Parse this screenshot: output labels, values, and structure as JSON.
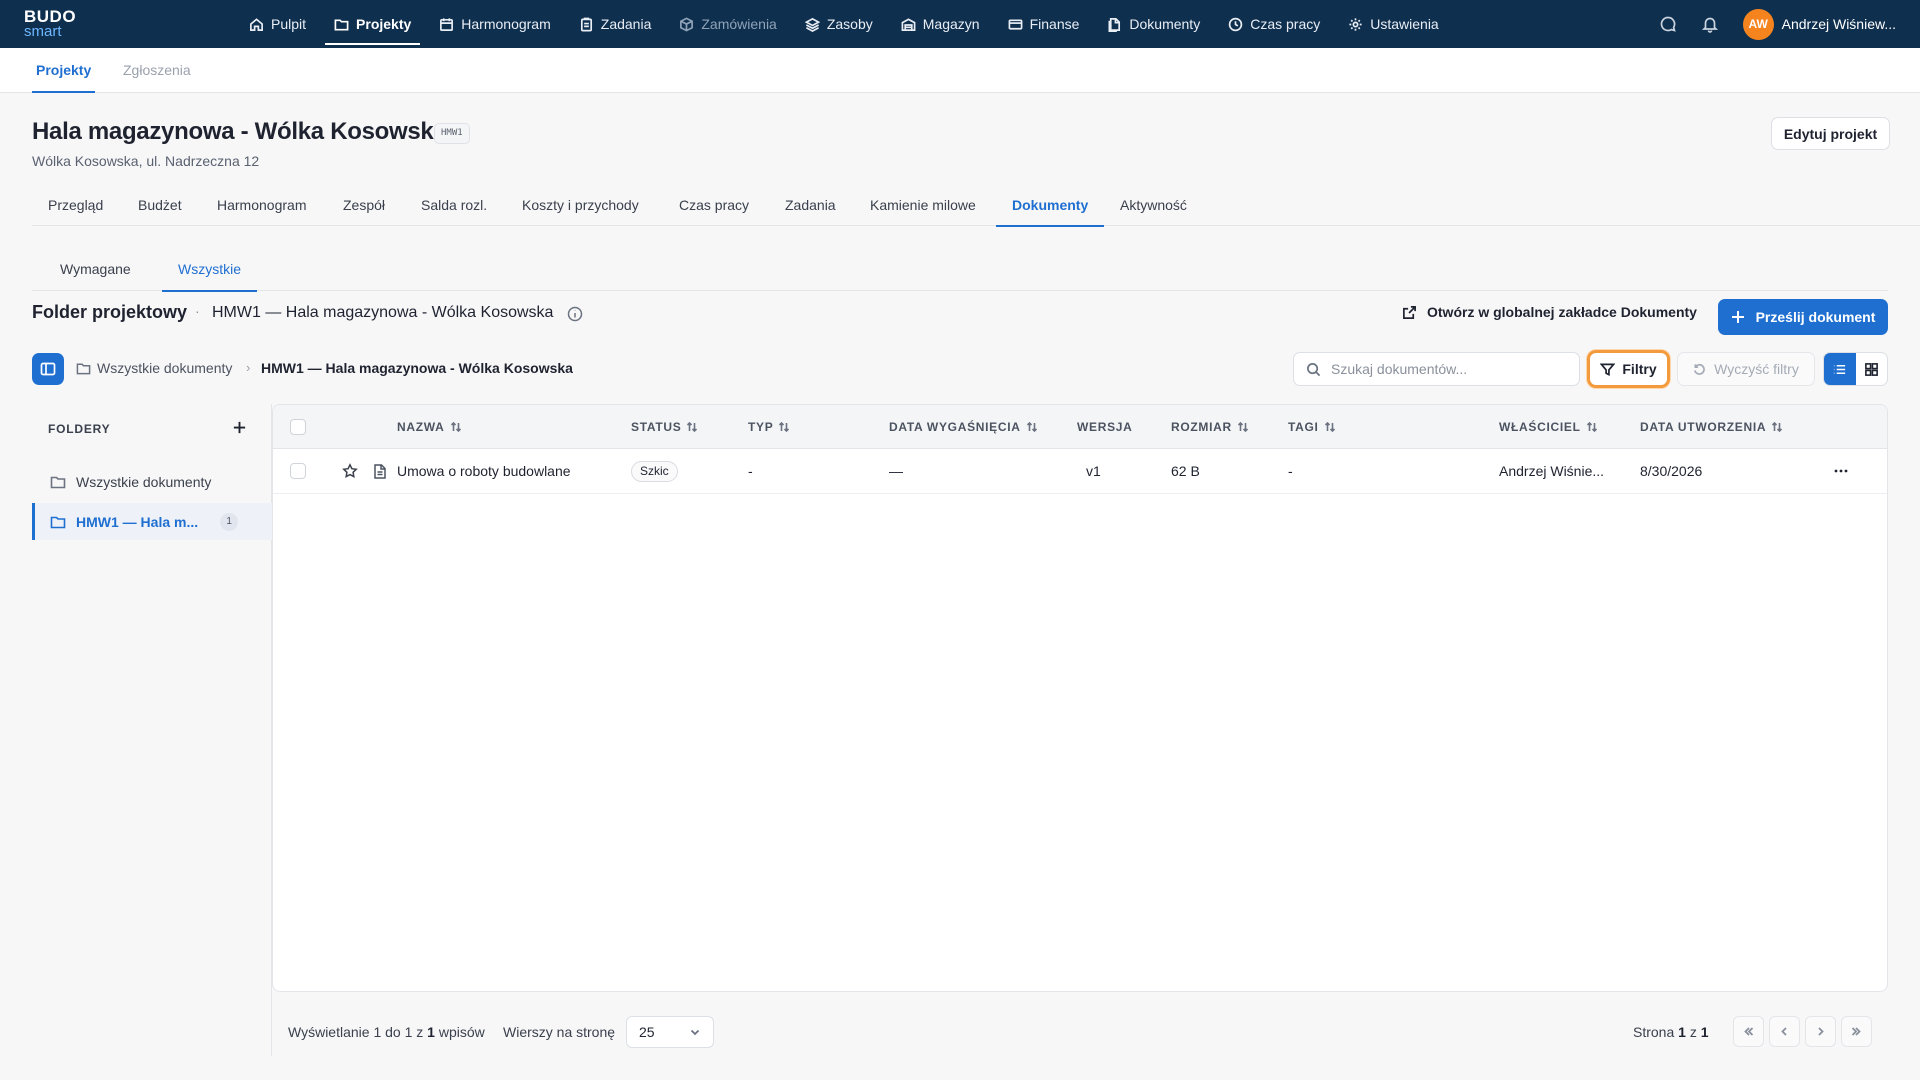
{
  "app": {
    "logo_line1": "BUDO",
    "logo_line2": "smart"
  },
  "topnav": {
    "items": [
      {
        "label": "Pulpit",
        "icon": "home-icon"
      },
      {
        "label": "Projekty",
        "icon": "folder-icon"
      },
      {
        "label": "Harmonogram",
        "icon": "calendar-icon"
      },
      {
        "label": "Zadania",
        "icon": "clipboard-icon"
      },
      {
        "label": "Zamówienia",
        "icon": "box-icon"
      },
      {
        "label": "Zasoby",
        "icon": "layers-icon"
      },
      {
        "label": "Magazyn",
        "icon": "warehouse-icon"
      },
      {
        "label": "Finanse",
        "icon": "card-icon"
      },
      {
        "label": "Dokumenty",
        "icon": "documents-icon"
      },
      {
        "label": "Czas pracy",
        "icon": "clock-icon"
      },
      {
        "label": "Ustawienia",
        "icon": "gear-icon"
      }
    ],
    "active": "Projekty",
    "user": {
      "initials": "AW",
      "name": "Andrzej Wiśniew..."
    }
  },
  "subnav": {
    "tabs": [
      "Projekty",
      "Zgłoszenia"
    ],
    "active": "Projekty"
  },
  "project": {
    "title": "Hala magazynowa - Wólka Kosowska",
    "code": "HMW1",
    "address": "Wólka Kosowska, ul. Nadrzeczna 12",
    "edit_label": "Edytuj projekt",
    "tabs": [
      "Przegląd",
      "Budżet",
      "Harmonogram",
      "Zespół",
      "Salda rozl.",
      "Koszty i przychody",
      "Czas pracy",
      "Zadania",
      "Kamienie milowe",
      "Dokumenty",
      "Aktywność"
    ],
    "active_tab": "Dokumenty"
  },
  "documents": {
    "tabs": [
      "Wymagane",
      "Wszystkie"
    ],
    "active_tab": "Wszystkie",
    "folder_title": "Folder projektowy",
    "folder_separator": "·",
    "folder_name": "HMW1 — Hala magazynowa - Wólka Kosowska",
    "open_global_label": "Otwórz w globalnej zakładce Dokumenty",
    "upload_label": "Prześlij dokument",
    "breadcrumb": {
      "root": "Wszystkie dokumenty",
      "current": "HMW1 — Hala magazynowa - Wólka Kosowska"
    },
    "search_placeholder": "Szukaj dokumentów...",
    "filters_label": "Filtry",
    "clear_filters_label": "Wyczyść filtry",
    "folders": {
      "heading": "FOLDERY",
      "items": [
        {
          "label": "Wszystkie dokumenty",
          "count": ""
        },
        {
          "label": "HMW1 — Hala m...",
          "count": "1"
        }
      ]
    },
    "columns": [
      "NAZWA",
      "STATUS",
      "TYP",
      "DATA WYGAŚNIĘCIA",
      "WERSJA",
      "ROZMIAR",
      "TAGI",
      "WŁAŚCICIEL",
      "DATA UTWORZENIA"
    ],
    "rows": [
      {
        "name": "Umowa o roboty budowlane",
        "status": "Szkic",
        "type": "-",
        "expiry": "—",
        "version": "v1",
        "size": "62 B",
        "tags": "-",
        "owner": "Andrzej Wiśnie...",
        "created": "8/30/2026"
      }
    ]
  },
  "pagination": {
    "info_prefix": "Wyświetlanie 1 do 1 z ",
    "info_total": "1",
    "info_suffix": " wpisów",
    "rows_label": "Wierszy na stronę",
    "rows_value": "25",
    "page_prefix": "Strona ",
    "page_current": "1",
    "page_mid": " z ",
    "page_total": "1"
  }
}
